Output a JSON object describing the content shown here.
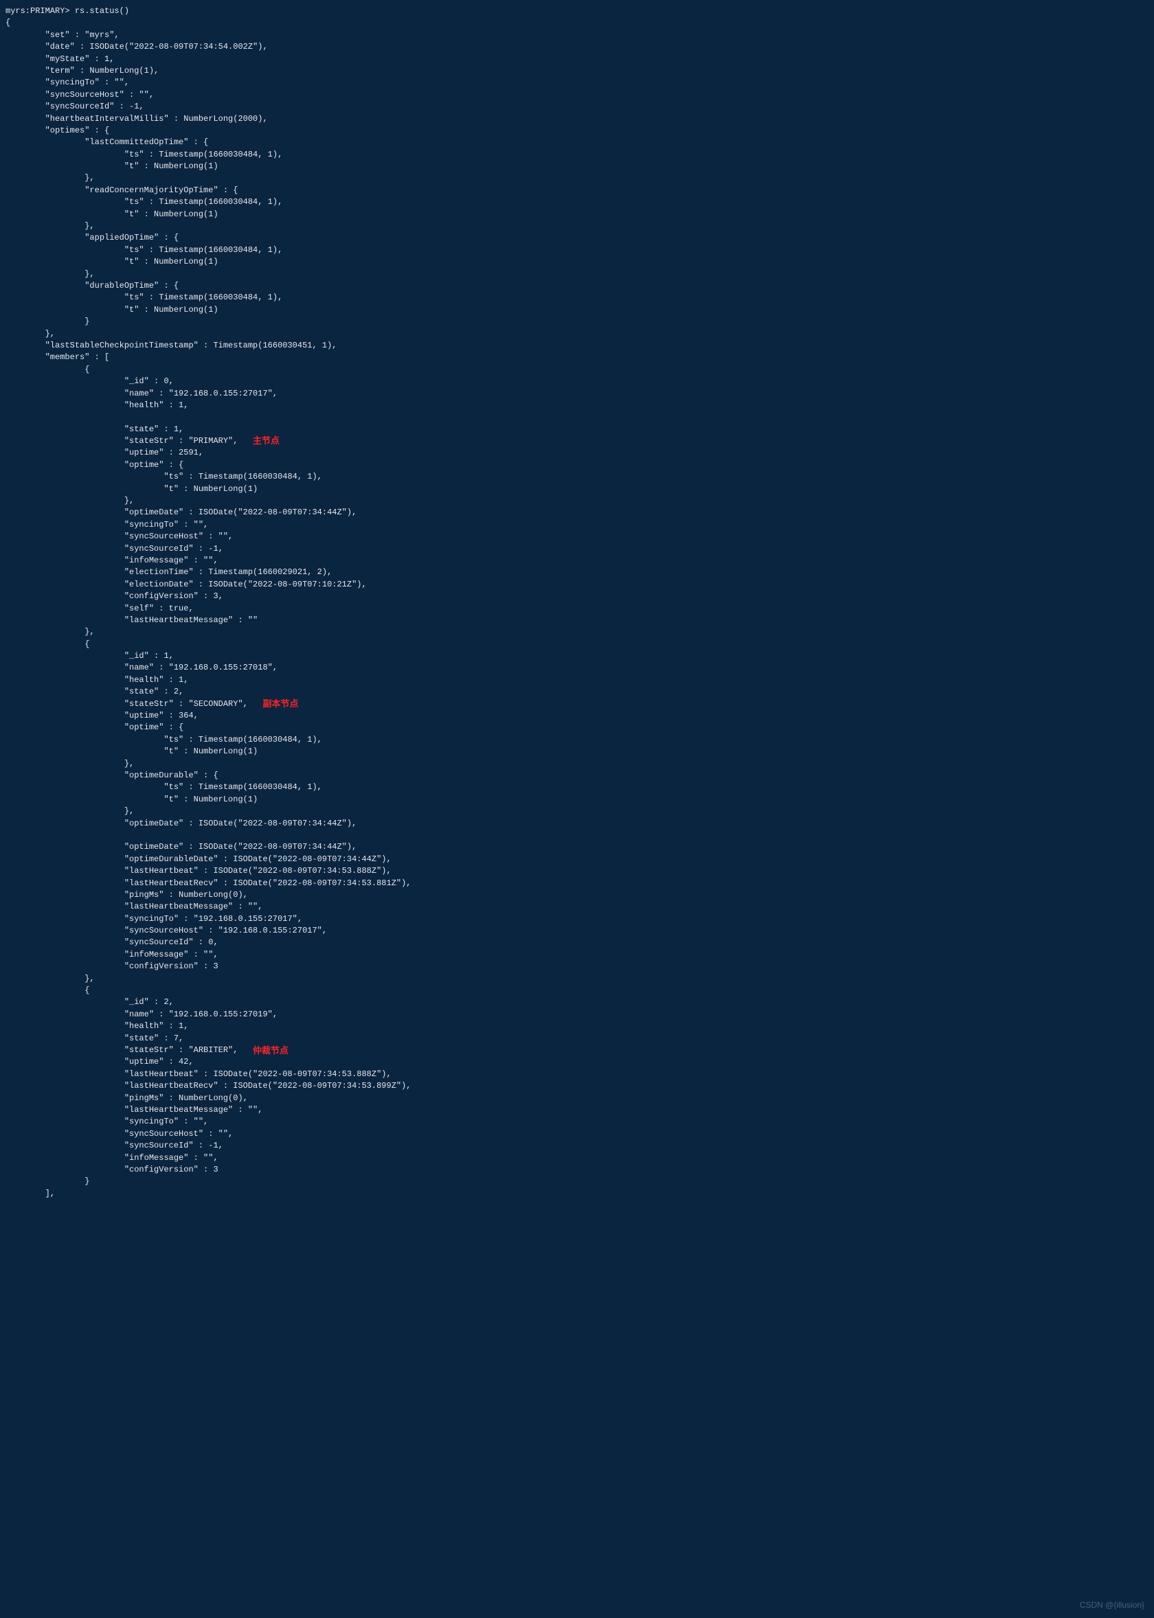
{
  "prompt_line": "myrs:PRIMARY> rs.status()",
  "annotations": {
    "primary": "主节点",
    "secondary": "副本节点",
    "arbiter": "仲裁节点"
  },
  "watermark": "CSDN @{illusion}",
  "rs_status": {
    "set": "myrs",
    "date": "ISODate(\"2022-08-09T07:34:54.002Z\")",
    "myState": 1,
    "term": "NumberLong(1)",
    "syncingTo": "",
    "syncSourceHost": "",
    "syncSourceId": -1,
    "heartbeatIntervalMillis": "NumberLong(2000)",
    "optimes": {
      "lastCommittedOpTime": {
        "ts": "Timestamp(1660030484, 1)",
        "t": "NumberLong(1)"
      },
      "readConcernMajorityOpTime": {
        "ts": "Timestamp(1660030484, 1)",
        "t": "NumberLong(1)"
      },
      "appliedOpTime": {
        "ts": "Timestamp(1660030484, 1)",
        "t": "NumberLong(1)"
      },
      "durableOpTime": {
        "ts": "Timestamp(1660030484, 1)",
        "t": "NumberLong(1)"
      }
    },
    "lastStableCheckpointTimestamp": "Timestamp(1660030451, 1)",
    "members": [
      {
        "_id": 0,
        "name": "192.168.0.155:27017",
        "health": 1,
        "state": 1,
        "stateStr": "PRIMARY",
        "uptime": 2591,
        "optime": {
          "ts": "Timestamp(1660030484, 1)",
          "t": "NumberLong(1)"
        },
        "optimeDate": "ISODate(\"2022-08-09T07:34:44Z\")",
        "syncingTo": "",
        "syncSourceHost": "",
        "syncSourceId": -1,
        "infoMessage": "",
        "electionTime": "Timestamp(1660029021, 2)",
        "electionDate": "ISODate(\"2022-08-09T07:10:21Z\")",
        "configVersion": 3,
        "self": "true",
        "lastHeartbeatMessage": ""
      },
      {
        "_id": 1,
        "name": "192.168.0.155:27018",
        "health": 1,
        "state": 2,
        "stateStr": "SECONDARY",
        "uptime": 364,
        "optime": {
          "ts": "Timestamp(1660030484, 1)",
          "t": "NumberLong(1)"
        },
        "optimeDurable": {
          "ts": "Timestamp(1660030484, 1)",
          "t": "NumberLong(1)"
        },
        "optimeDate": "ISODate(\"2022-08-09T07:34:44Z\")",
        "optimeDate2": "ISODate(\"2022-08-09T07:34:44Z\")",
        "optimeDurableDate": "ISODate(\"2022-08-09T07:34:44Z\")",
        "lastHeartbeat": "ISODate(\"2022-08-09T07:34:53.888Z\")",
        "lastHeartbeatRecv": "ISODate(\"2022-08-09T07:34:53.881Z\")",
        "pingMs": "NumberLong(0)",
        "lastHeartbeatMessage": "",
        "syncingTo": "192.168.0.155:27017",
        "syncSourceHost": "192.168.0.155:27017",
        "syncSourceId": 0,
        "infoMessage": "",
        "configVersion": 3
      },
      {
        "_id": 2,
        "name": "192.168.0.155:27019",
        "health": 1,
        "state": 7,
        "stateStr": "ARBITER",
        "uptime": 42,
        "lastHeartbeat": "ISODate(\"2022-08-09T07:34:53.888Z\")",
        "lastHeartbeatRecv": "ISODate(\"2022-08-09T07:34:53.899Z\")",
        "pingMs": "NumberLong(0)",
        "lastHeartbeatMessage": "",
        "syncingTo": "",
        "syncSourceHost": "",
        "syncSourceId": -1,
        "infoMessage": "",
        "configVersion": 3
      }
    ]
  }
}
